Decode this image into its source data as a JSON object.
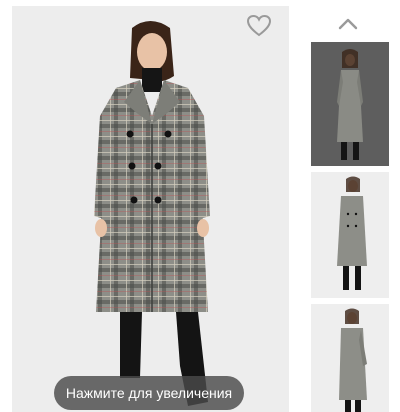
{
  "gallery": {
    "zoom_hint": "Нажмите для увеличения",
    "favorite_icon": "heart-outline-icon",
    "scroll_up_icon": "chevron-up-icon",
    "thumbnails": [
      {
        "background": "#5e5e5e"
      },
      {
        "background": "#eeeeee"
      },
      {
        "background": "#eeeeee"
      }
    ]
  },
  "colors": {
    "main_background": "#ededed",
    "coat_base": "#8d8e88",
    "coat_check": "#3d3f3c",
    "coat_stripe": "#c9c4b4",
    "boots": "#141414",
    "icon": "#9a9a9a",
    "zoom_pill": "#4b4b4b"
  }
}
